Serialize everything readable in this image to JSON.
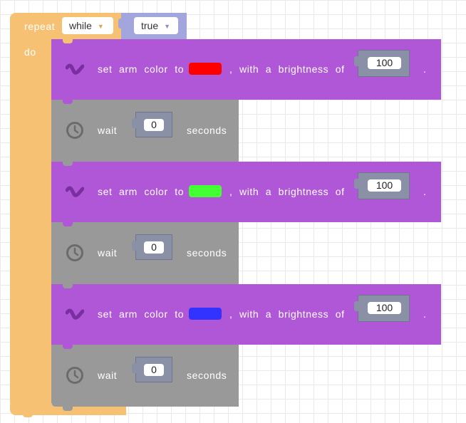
{
  "repeat_block": {
    "repeat_label": "repeat",
    "mode_value": "while",
    "condition_value": "true",
    "do_label": "do"
  },
  "blocks": [
    {
      "type": "set_arm_color",
      "text_prefix": "set arm color to",
      "color": "#ff0000",
      "text_mid": ", with a brightness of",
      "brightness": "100",
      "text_suffix": "."
    },
    {
      "type": "wait",
      "text_prefix": "wait",
      "seconds": "0",
      "text_suffix": "seconds"
    },
    {
      "type": "set_arm_color",
      "text_prefix": "set arm color to",
      "color": "#44ff33",
      "text_mid": ", with a brightness of",
      "brightness": "100",
      "text_suffix": "."
    },
    {
      "type": "wait",
      "text_prefix": "wait",
      "seconds": "0",
      "text_suffix": "seconds"
    },
    {
      "type": "set_arm_color",
      "text_prefix": "set arm color to",
      "color": "#3333ff",
      "text_mid": ", with a brightness of",
      "brightness": "100",
      "text_suffix": "."
    },
    {
      "type": "wait",
      "text_prefix": "wait",
      "seconds": "0",
      "text_suffix": "seconds"
    }
  ],
  "icons": {
    "arm": "arm-icon",
    "clock": "clock-icon"
  },
  "colors": {
    "repeat": "#f6c173",
    "logic": "#a3a6dc",
    "arm_block": "#b057d7",
    "wait_block": "#999999",
    "number_slot": "#8a90a6"
  }
}
